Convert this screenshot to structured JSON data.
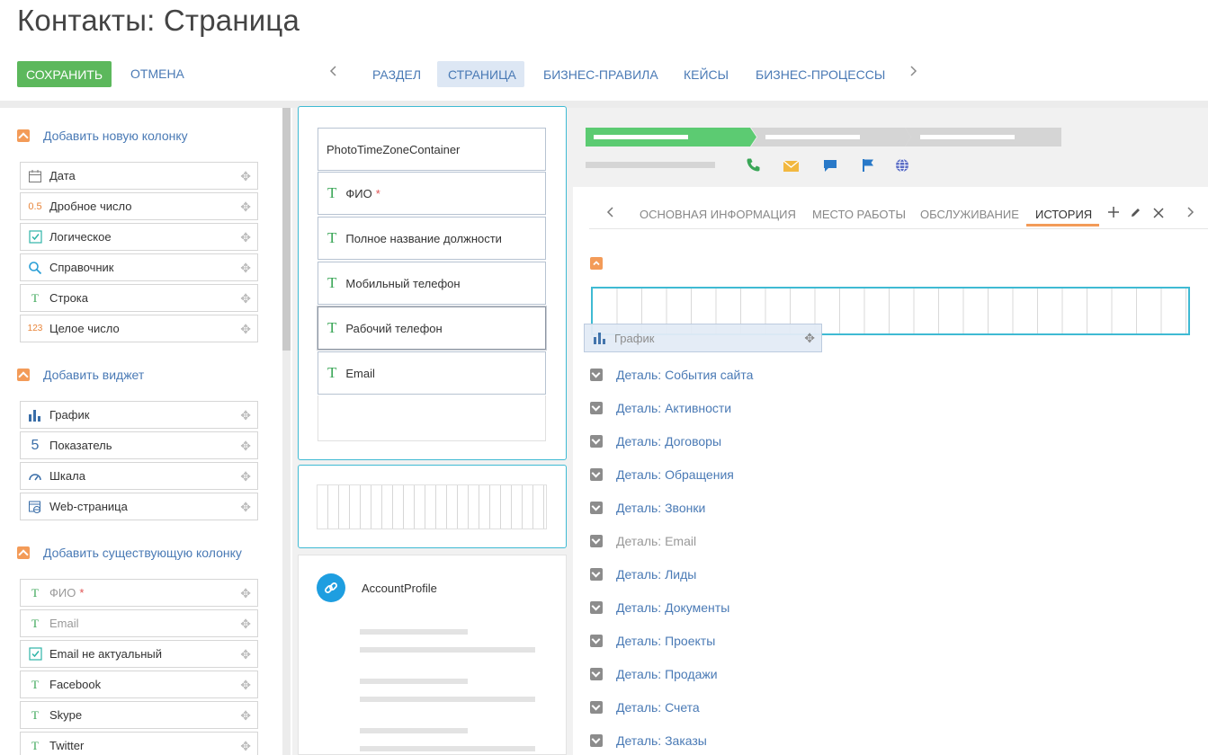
{
  "title": "Контакты: Страница",
  "toolbar": {
    "save_label": "СОХРАНИТЬ",
    "cancel_label": "ОТМЕНА"
  },
  "tabs": [
    {
      "label": "РАЗДЕЛ"
    },
    {
      "label": "СТРАНИЦА"
    },
    {
      "label": "БИЗНЕС-ПРАВИЛА"
    },
    {
      "label": "КЕЙСЫ"
    },
    {
      "label": "БИЗНЕС-ПРОЦЕССЫ"
    }
  ],
  "left": {
    "group_new_column": "Добавить новую колонку",
    "new_columns": [
      {
        "label": "Дата",
        "icon": "calendar-icon"
      },
      {
        "label": "Дробное число",
        "icon": "decimal-icon",
        "icon_text": "0.5"
      },
      {
        "label": "Логическое",
        "icon": "checkbox-icon"
      },
      {
        "label": "Справочник",
        "icon": "search-icon"
      },
      {
        "label": "Строка",
        "icon": "text-icon",
        "icon_text": "T"
      },
      {
        "label": "Целое число",
        "icon": "integer-icon",
        "icon_text": "123"
      }
    ],
    "group_widget": "Добавить виджет",
    "widgets": [
      {
        "label": "График",
        "icon": "chart-icon"
      },
      {
        "label": "Показатель",
        "icon": "indicator-icon",
        "icon_text": "5"
      },
      {
        "label": "Шкала",
        "icon": "gauge-icon"
      },
      {
        "label": "Web-страница",
        "icon": "web-page-icon"
      }
    ],
    "group_existing": "Добавить существующую колонку",
    "existing": [
      {
        "label": "ФИО",
        "icon": "text-icon",
        "icon_text": "T",
        "required": "*"
      },
      {
        "label": "Email",
        "icon": "text-icon",
        "icon_text": "T"
      },
      {
        "label": "Email не актуальный",
        "icon": "checkbox-icon"
      },
      {
        "label": "Facebook",
        "icon": "text-icon",
        "icon_text": "T"
      },
      {
        "label": "Skype",
        "icon": "text-icon",
        "icon_text": "T"
      },
      {
        "label": "Twitter",
        "icon": "text-icon",
        "icon_text": "T"
      }
    ]
  },
  "middle": {
    "container_label": "PhotoTimeZoneContainer",
    "fields": [
      {
        "label": "ФИО",
        "required": "*"
      },
      {
        "label": "Полное название должности"
      },
      {
        "label": "Мобильный телефон"
      },
      {
        "label": "Рабочий телефон"
      },
      {
        "label": "Email"
      }
    ],
    "account_profile": "AccountProfile"
  },
  "right": {
    "tabs": [
      {
        "label": "ОСНОВНАЯ ИНФОРМАЦИЯ"
      },
      {
        "label": "МЕСТО РАБОТЫ"
      },
      {
        "label": "ОБСЛУЖИВАНИЕ"
      },
      {
        "label": "ИСТОРИЯ"
      }
    ],
    "drag_item": "График",
    "details": [
      {
        "label": "Деталь: События сайта"
      },
      {
        "label": "Деталь: Активности"
      },
      {
        "label": "Деталь: Договоры"
      },
      {
        "label": "Деталь: Обращения"
      },
      {
        "label": "Деталь: Звонки"
      },
      {
        "label": "Деталь: Email"
      },
      {
        "label": "Деталь: Лиды"
      },
      {
        "label": "Деталь: Документы"
      },
      {
        "label": "Деталь: Проекты"
      },
      {
        "label": "Деталь: Продажи"
      },
      {
        "label": "Деталь: Счета"
      },
      {
        "label": "Деталь: Заказы"
      }
    ]
  },
  "colors": {
    "accent": "#4a7ab5",
    "save": "#5cb85c",
    "toggle": "#f39b58",
    "drop_border": "#3fbad3",
    "stage_active": "#5ccb72"
  }
}
